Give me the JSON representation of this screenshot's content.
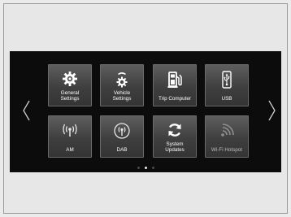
{
  "home_screen": {
    "tiles_row1": [
      {
        "label": "General\nSettings",
        "icon": "gear-icon"
      },
      {
        "label": "Vehicle\nSettings",
        "icon": "vehicle-gear-icon"
      },
      {
        "label": "Trip Computer",
        "icon": "fuel-pump-icon"
      },
      {
        "label": "USB",
        "icon": "usb-icon"
      }
    ],
    "tiles_row2": [
      {
        "label": "AM",
        "icon": "am-antenna-icon"
      },
      {
        "label": "DAB",
        "icon": "dab-antenna-icon"
      },
      {
        "label": "System\nUpdates",
        "icon": "refresh-icon"
      },
      {
        "label": "Wi-Fi Hotspot",
        "icon": "wifi-icon"
      }
    ],
    "page_indicator": {
      "pages": 3,
      "current": 2
    },
    "navigation": {
      "prev_icon": "chevron-left-icon",
      "next_icon": "chevron-right-icon"
    }
  },
  "colors": {
    "screen_background": "#0c0c0c",
    "tile_top": "#5e5e5e",
    "tile_bottom": "#343434",
    "active_dot": "#e8e8e8",
    "inactive_dot": "#4a4a4a"
  }
}
